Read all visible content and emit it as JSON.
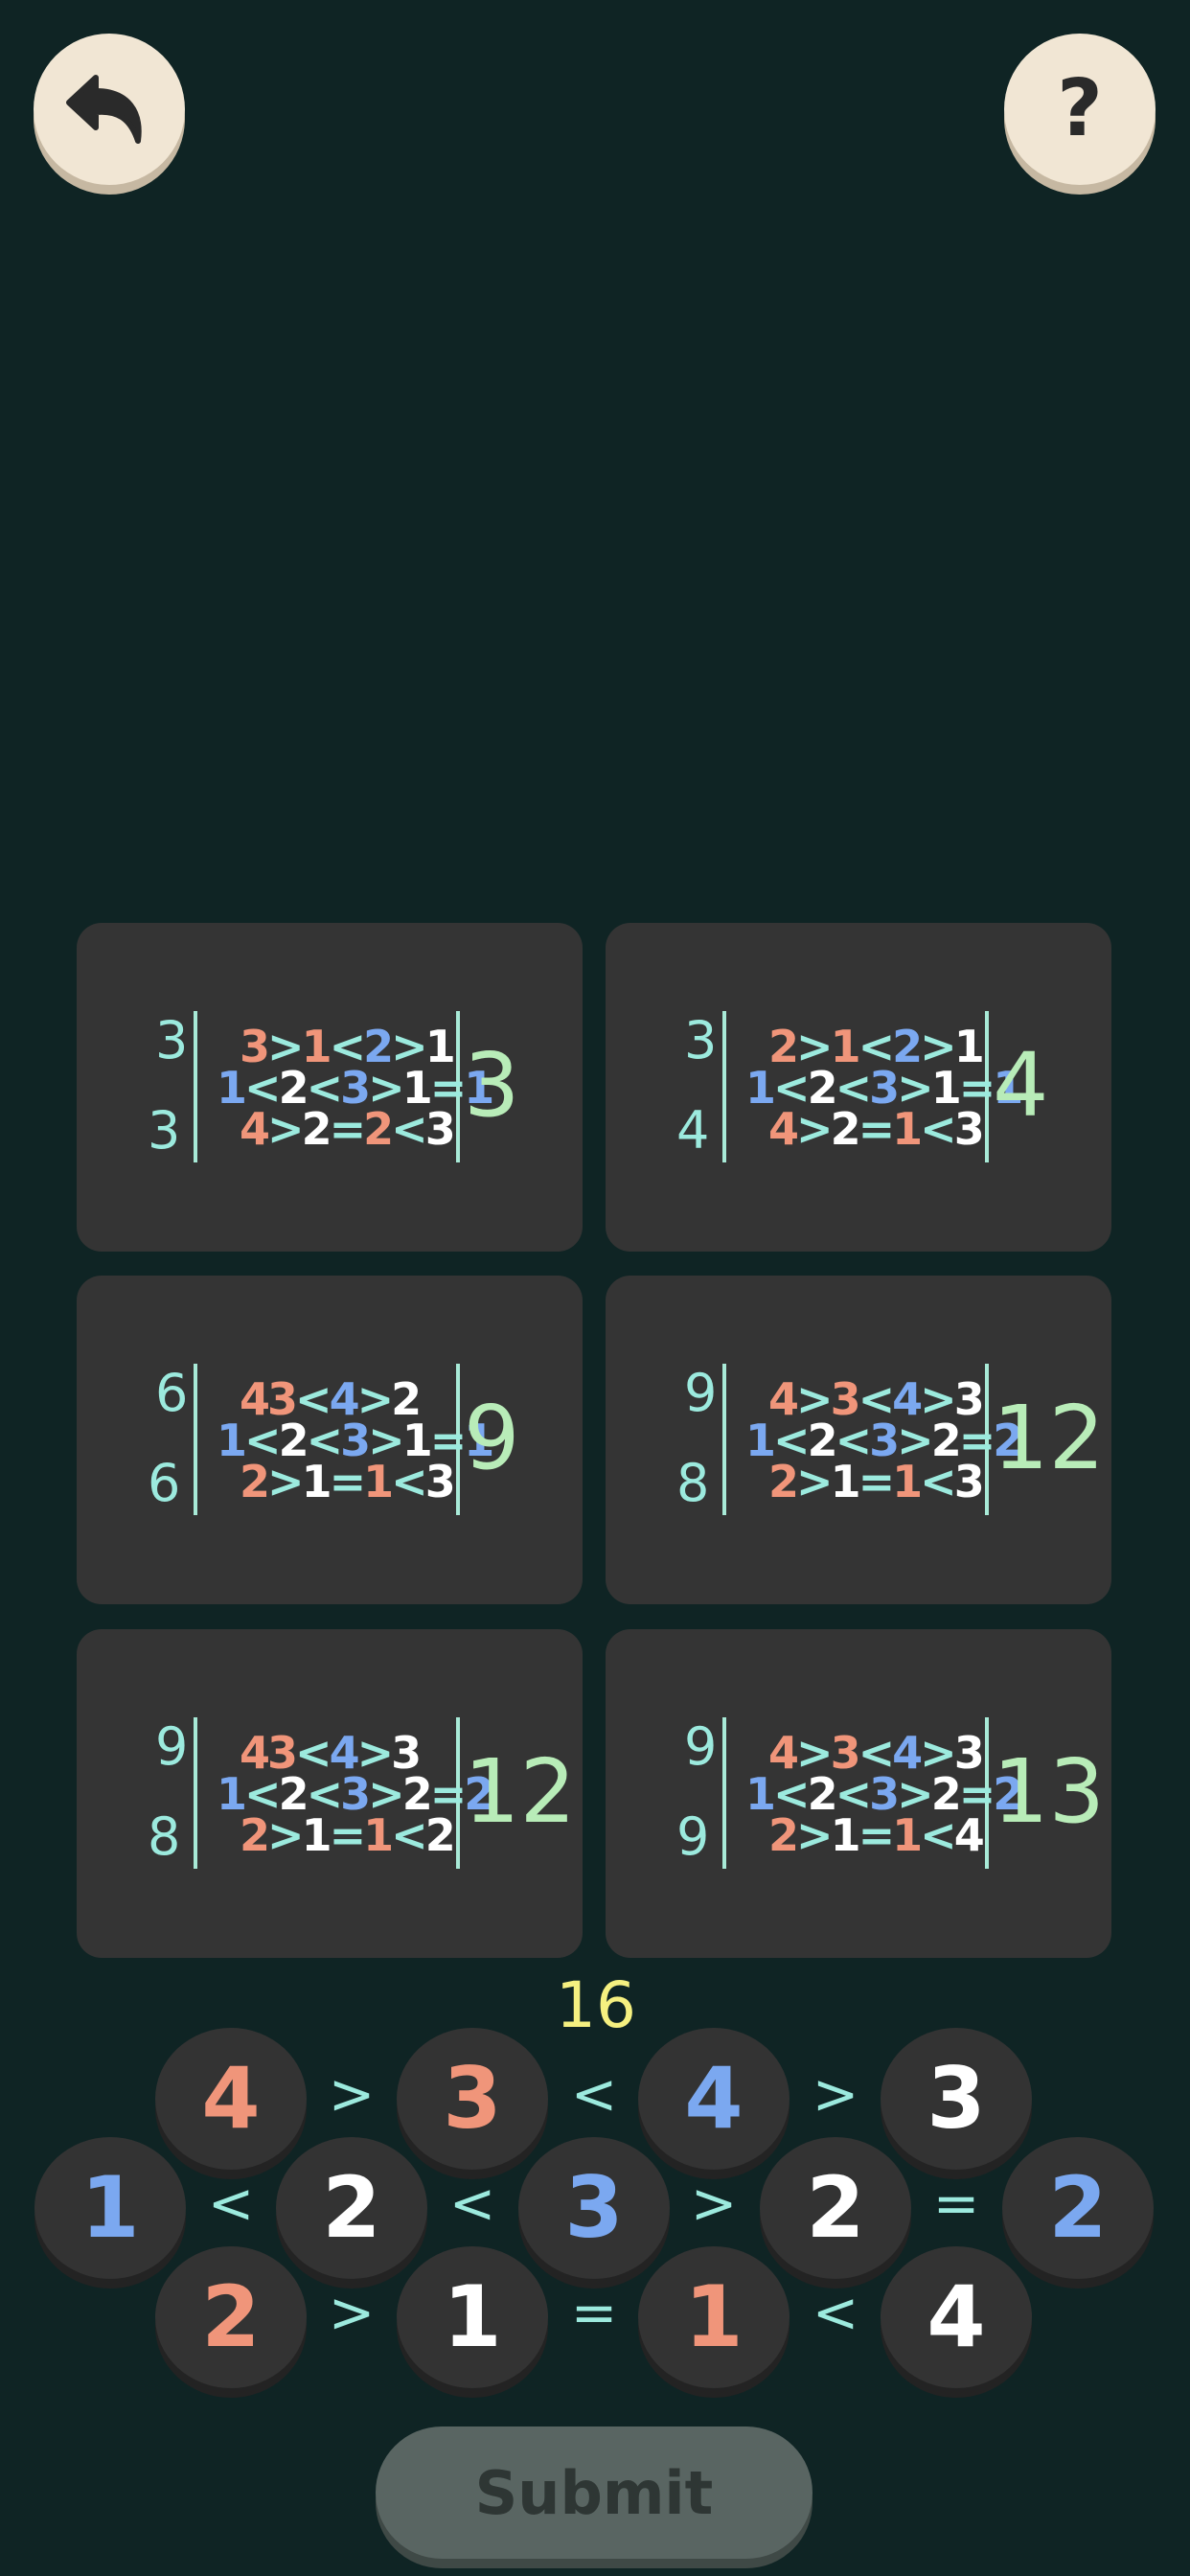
{
  "header": {
    "help_label": "?"
  },
  "cards": [
    {
      "left_top": "3",
      "left_bottom": "3",
      "score": "3",
      "rows": [
        [
          {
            "t": "3",
            "c": "coral"
          },
          {
            "t": ">",
            "c": "sym"
          },
          {
            "t": "1",
            "c": "coral"
          },
          {
            "t": "<",
            "c": "sym"
          },
          {
            "t": "2",
            "c": "blue"
          },
          {
            "t": ">",
            "c": "sym"
          },
          {
            "t": "1",
            "c": "white"
          }
        ],
        [
          {
            "t": "1",
            "c": "blue"
          },
          {
            "t": "<",
            "c": "sym"
          },
          {
            "t": "2",
            "c": "white"
          },
          {
            "t": "<",
            "c": "sym"
          },
          {
            "t": "3",
            "c": "blue"
          },
          {
            "t": ">",
            "c": "sym"
          },
          {
            "t": "1",
            "c": "white"
          },
          {
            "t": "=",
            "c": "sym"
          },
          {
            "t": "1",
            "c": "blue"
          }
        ],
        [
          {
            "t": "4",
            "c": "coral"
          },
          {
            "t": ">",
            "c": "sym"
          },
          {
            "t": "2",
            "c": "white"
          },
          {
            "t": "=",
            "c": "sym"
          },
          {
            "t": "2",
            "c": "coral"
          },
          {
            "t": "<",
            "c": "sym"
          },
          {
            "t": "3",
            "c": "white"
          }
        ]
      ]
    },
    {
      "left_top": "3",
      "left_bottom": "4",
      "score": "4",
      "rows": [
        [
          {
            "t": "2",
            "c": "coral"
          },
          {
            "t": ">",
            "c": "sym"
          },
          {
            "t": "1",
            "c": "coral"
          },
          {
            "t": "<",
            "c": "sym"
          },
          {
            "t": "2",
            "c": "blue"
          },
          {
            "t": ">",
            "c": "sym"
          },
          {
            "t": "1",
            "c": "white"
          }
        ],
        [
          {
            "t": "1",
            "c": "blue"
          },
          {
            "t": "<",
            "c": "sym"
          },
          {
            "t": "2",
            "c": "white"
          },
          {
            "t": "<",
            "c": "sym"
          },
          {
            "t": "3",
            "c": "blue"
          },
          {
            "t": ">",
            "c": "sym"
          },
          {
            "t": "1",
            "c": "white"
          },
          {
            "t": "=",
            "c": "sym"
          },
          {
            "t": "1",
            "c": "blue"
          }
        ],
        [
          {
            "t": "4",
            "c": "coral"
          },
          {
            "t": ">",
            "c": "sym"
          },
          {
            "t": "2",
            "c": "white"
          },
          {
            "t": "=",
            "c": "sym"
          },
          {
            "t": "1",
            "c": "coral"
          },
          {
            "t": "<",
            "c": "sym"
          },
          {
            "t": "3",
            "c": "white"
          }
        ]
      ]
    },
    {
      "left_top": "6",
      "left_bottom": "6",
      "score": "9",
      "rows": [
        [
          {
            "t": "4",
            "c": "coral"
          },
          {
            "t": "3",
            "c": "coral"
          },
          {
            "t": "<",
            "c": "sym"
          },
          {
            "t": "4",
            "c": "blue"
          },
          {
            "t": ">",
            "c": "sym"
          },
          {
            "t": "2",
            "c": "white"
          }
        ],
        [
          {
            "t": "1",
            "c": "blue"
          },
          {
            "t": "<",
            "c": "sym"
          },
          {
            "t": "2",
            "c": "white"
          },
          {
            "t": "<",
            "c": "sym"
          },
          {
            "t": "3",
            "c": "blue"
          },
          {
            "t": ">",
            "c": "sym"
          },
          {
            "t": "1",
            "c": "white"
          },
          {
            "t": "=",
            "c": "sym"
          },
          {
            "t": "1",
            "c": "blue"
          }
        ],
        [
          {
            "t": "2",
            "c": "coral"
          },
          {
            "t": ">",
            "c": "sym"
          },
          {
            "t": "1",
            "c": "white"
          },
          {
            "t": "=",
            "c": "sym"
          },
          {
            "t": "1",
            "c": "coral"
          },
          {
            "t": "<",
            "c": "sym"
          },
          {
            "t": "3",
            "c": "white"
          }
        ]
      ]
    },
    {
      "left_top": "9",
      "left_bottom": "8",
      "score": "12",
      "rows": [
        [
          {
            "t": "4",
            "c": "coral"
          },
          {
            "t": ">",
            "c": "sym"
          },
          {
            "t": "3",
            "c": "coral"
          },
          {
            "t": "<",
            "c": "sym"
          },
          {
            "t": "4",
            "c": "blue"
          },
          {
            "t": ">",
            "c": "sym"
          },
          {
            "t": "3",
            "c": "white"
          }
        ],
        [
          {
            "t": "1",
            "c": "blue"
          },
          {
            "t": "<",
            "c": "sym"
          },
          {
            "t": "2",
            "c": "white"
          },
          {
            "t": "<",
            "c": "sym"
          },
          {
            "t": "3",
            "c": "blue"
          },
          {
            "t": ">",
            "c": "sym"
          },
          {
            "t": "2",
            "c": "white"
          },
          {
            "t": "=",
            "c": "sym"
          },
          {
            "t": "2",
            "c": "blue"
          }
        ],
        [
          {
            "t": "2",
            "c": "coral"
          },
          {
            "t": ">",
            "c": "sym"
          },
          {
            "t": "1",
            "c": "white"
          },
          {
            "t": "=",
            "c": "sym"
          },
          {
            "t": "1",
            "c": "coral"
          },
          {
            "t": "<",
            "c": "sym"
          },
          {
            "t": "3",
            "c": "white"
          }
        ]
      ]
    },
    {
      "left_top": "9",
      "left_bottom": "8",
      "score": "12",
      "rows": [
        [
          {
            "t": "4",
            "c": "coral"
          },
          {
            "t": "3",
            "c": "coral"
          },
          {
            "t": "<",
            "c": "sym"
          },
          {
            "t": "4",
            "c": "blue"
          },
          {
            "t": ">",
            "c": "sym"
          },
          {
            "t": "3",
            "c": "white"
          }
        ],
        [
          {
            "t": "1",
            "c": "blue"
          },
          {
            "t": "<",
            "c": "sym"
          },
          {
            "t": "2",
            "c": "white"
          },
          {
            "t": "<",
            "c": "sym"
          },
          {
            "t": "3",
            "c": "blue"
          },
          {
            "t": ">",
            "c": "sym"
          },
          {
            "t": "2",
            "c": "white"
          },
          {
            "t": "=",
            "c": "sym"
          },
          {
            "t": "2",
            "c": "blue"
          }
        ],
        [
          {
            "t": "2",
            "c": "coral"
          },
          {
            "t": ">",
            "c": "sym"
          },
          {
            "t": "1",
            "c": "white"
          },
          {
            "t": "=",
            "c": "sym"
          },
          {
            "t": "1",
            "c": "coral"
          },
          {
            "t": "<",
            "c": "sym"
          },
          {
            "t": "2",
            "c": "white"
          }
        ]
      ]
    },
    {
      "left_top": "9",
      "left_bottom": "9",
      "score": "13",
      "rows": [
        [
          {
            "t": "4",
            "c": "coral"
          },
          {
            "t": ">",
            "c": "sym"
          },
          {
            "t": "3",
            "c": "coral"
          },
          {
            "t": "<",
            "c": "sym"
          },
          {
            "t": "4",
            "c": "blue"
          },
          {
            "t": ">",
            "c": "sym"
          },
          {
            "t": "3",
            "c": "white"
          }
        ],
        [
          {
            "t": "1",
            "c": "blue"
          },
          {
            "t": "<",
            "c": "sym"
          },
          {
            "t": "2",
            "c": "white"
          },
          {
            "t": "<",
            "c": "sym"
          },
          {
            "t": "3",
            "c": "blue"
          },
          {
            "t": ">",
            "c": "sym"
          },
          {
            "t": "2",
            "c": "white"
          },
          {
            "t": "=",
            "c": "sym"
          },
          {
            "t": "2",
            "c": "blue"
          }
        ],
        [
          {
            "t": "2",
            "c": "coral"
          },
          {
            "t": ">",
            "c": "sym"
          },
          {
            "t": "1",
            "c": "white"
          },
          {
            "t": "=",
            "c": "sym"
          },
          {
            "t": "1",
            "c": "coral"
          },
          {
            "t": "<",
            "c": "sym"
          },
          {
            "t": "4",
            "c": "white"
          }
        ]
      ]
    }
  ],
  "board": {
    "target": "16",
    "top": {
      "tiles": [
        {
          "v": "4",
          "c": "coral"
        },
        {
          "v": "3",
          "c": "coral"
        },
        {
          "v": "4",
          "c": "blue"
        },
        {
          "v": "3",
          "c": "white"
        }
      ],
      "ops": [
        ">",
        "<",
        ">"
      ]
    },
    "middle": {
      "tiles": [
        {
          "v": "1",
          "c": "blue"
        },
        {
          "v": "2",
          "c": "white"
        },
        {
          "v": "3",
          "c": "blue"
        },
        {
          "v": "2",
          "c": "white"
        },
        {
          "v": "2",
          "c": "blue"
        }
      ],
      "ops": [
        "<",
        "<",
        ">",
        "="
      ]
    },
    "bottom": {
      "tiles": [
        {
          "v": "2",
          "c": "coral"
        },
        {
          "v": "1",
          "c": "white"
        },
        {
          "v": "1",
          "c": "coral"
        },
        {
          "v": "4",
          "c": "white"
        }
      ],
      "ops": [
        ">",
        "=",
        "<"
      ]
    }
  },
  "submit": {
    "label": "Submit"
  },
  "colors": {
    "background": "#0f2424",
    "coral": "#f0957a",
    "blue": "#7ba8f0",
    "white": "#ffffff",
    "symbol": "#9ceade",
    "target": "#f5f080",
    "score": "#b8ecb8"
  },
  "icons": {
    "back": "undo-arrow-icon",
    "help": "question-mark-icon"
  }
}
